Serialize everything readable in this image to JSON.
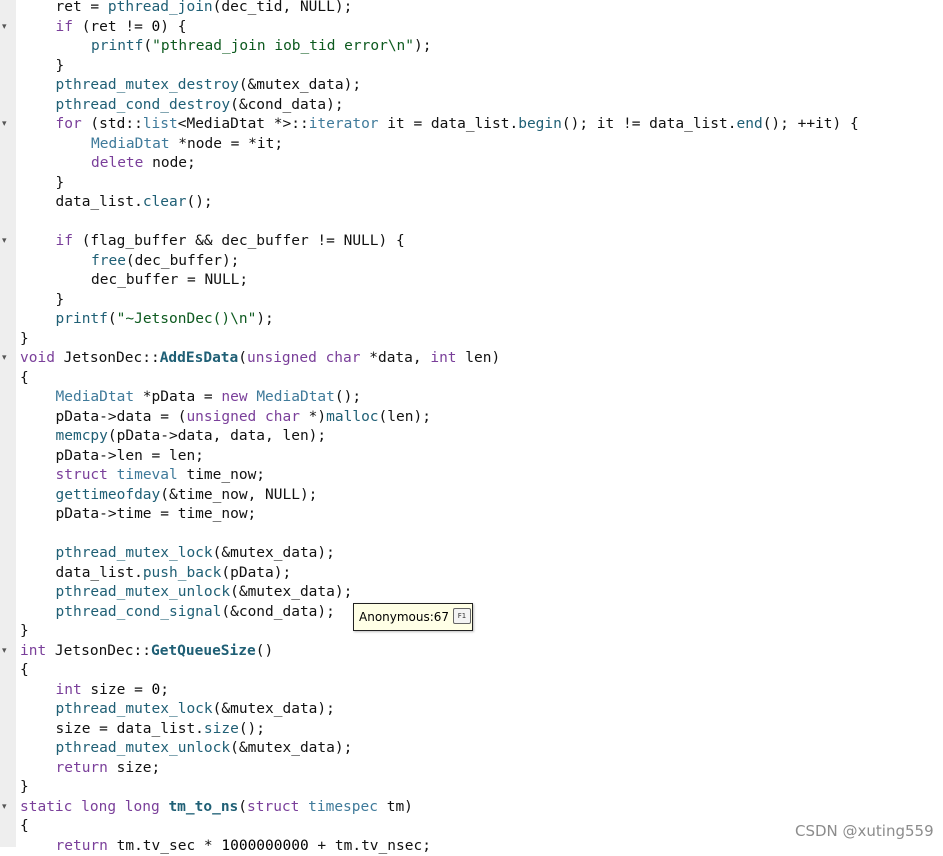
{
  "editor": {
    "lines": [
      {
        "fold": false,
        "indent": 1,
        "tokens": [
          [
            "pl",
            "ret = "
          ],
          [
            "fn",
            "pthread_join"
          ],
          [
            "pl",
            "(dec_tid, NULL);"
          ]
        ]
      },
      {
        "fold": true,
        "indent": 1,
        "tokens": [
          [
            "kw",
            "if"
          ],
          [
            "pl",
            " (ret != "
          ],
          [
            "nm",
            "0"
          ],
          [
            "pl",
            ") {"
          ]
        ]
      },
      {
        "fold": false,
        "indent": 2,
        "tokens": [
          [
            "fn",
            "printf"
          ],
          [
            "pl",
            "("
          ],
          [
            "st",
            "\"pthread_join iob_tid error\\n\""
          ],
          [
            "pl",
            ");"
          ]
        ]
      },
      {
        "fold": false,
        "indent": 1,
        "tokens": [
          [
            "pl",
            "}"
          ]
        ]
      },
      {
        "fold": false,
        "indent": 1,
        "tokens": [
          [
            "fn",
            "pthread_mutex_destroy"
          ],
          [
            "pl",
            "(&mutex_data);"
          ]
        ]
      },
      {
        "fold": false,
        "indent": 1,
        "tokens": [
          [
            "fn",
            "pthread_cond_destroy"
          ],
          [
            "pl",
            "(&cond_data);"
          ]
        ]
      },
      {
        "fold": true,
        "indent": 1,
        "tokens": [
          [
            "kw",
            "for"
          ],
          [
            "pl",
            " (std::"
          ],
          [
            "ty",
            "list"
          ],
          [
            "pl",
            "<MediaDtat *>::"
          ],
          [
            "ty",
            "iterator"
          ],
          [
            "pl",
            " it = data_list."
          ],
          [
            "fn",
            "begin"
          ],
          [
            "pl",
            "(); it != data_list."
          ],
          [
            "fn",
            "end"
          ],
          [
            "pl",
            "(); ++it) {"
          ]
        ]
      },
      {
        "fold": false,
        "indent": 2,
        "tokens": [
          [
            "ty",
            "MediaDtat"
          ],
          [
            "pl",
            " *node = *it;"
          ]
        ]
      },
      {
        "fold": false,
        "indent": 2,
        "tokens": [
          [
            "kw",
            "delete"
          ],
          [
            "pl",
            " node;"
          ]
        ]
      },
      {
        "fold": false,
        "indent": 1,
        "tokens": [
          [
            "pl",
            "}"
          ]
        ]
      },
      {
        "fold": false,
        "indent": 1,
        "tokens": [
          [
            "pl",
            "data_list."
          ],
          [
            "fn",
            "clear"
          ],
          [
            "pl",
            "();"
          ]
        ]
      },
      {
        "fold": false,
        "indent": 0,
        "tokens": []
      },
      {
        "fold": true,
        "indent": 1,
        "tokens": [
          [
            "kw",
            "if"
          ],
          [
            "pl",
            " (flag_buffer && dec_buffer != NULL) {"
          ]
        ]
      },
      {
        "fold": false,
        "indent": 2,
        "tokens": [
          [
            "fn",
            "free"
          ],
          [
            "pl",
            "(dec_buffer);"
          ]
        ]
      },
      {
        "fold": false,
        "indent": 2,
        "tokens": [
          [
            "pl",
            "dec_buffer = NULL;"
          ]
        ]
      },
      {
        "fold": false,
        "indent": 1,
        "tokens": [
          [
            "pl",
            "}"
          ]
        ]
      },
      {
        "fold": false,
        "indent": 1,
        "tokens": [
          [
            "fn",
            "printf"
          ],
          [
            "pl",
            "("
          ],
          [
            "st",
            "\"~JetsonDec()\\n\""
          ],
          [
            "pl",
            ");"
          ]
        ]
      },
      {
        "fold": false,
        "indent": 0,
        "tokens": [
          [
            "pl",
            "}"
          ]
        ]
      },
      {
        "fold": true,
        "indent": 0,
        "tokens": [
          [
            "kw",
            "void"
          ],
          [
            "pl",
            " JetsonDec::"
          ],
          [
            "fd",
            "AddEsData"
          ],
          [
            "pl",
            "("
          ],
          [
            "kw",
            "unsigned"
          ],
          [
            "pl",
            " "
          ],
          [
            "kw",
            "char"
          ],
          [
            "pl",
            " *data, "
          ],
          [
            "kw",
            "int"
          ],
          [
            "pl",
            " len)"
          ]
        ]
      },
      {
        "fold": false,
        "indent": 0,
        "tokens": [
          [
            "pl",
            "{"
          ]
        ]
      },
      {
        "fold": false,
        "indent": 1,
        "tokens": [
          [
            "ty",
            "MediaDtat"
          ],
          [
            "pl",
            " *pData = "
          ],
          [
            "kw",
            "new"
          ],
          [
            "pl",
            " "
          ],
          [
            "ty",
            "MediaDtat"
          ],
          [
            "pl",
            "();"
          ]
        ]
      },
      {
        "fold": false,
        "indent": 1,
        "tokens": [
          [
            "pl",
            "pData->data = ("
          ],
          [
            "kw",
            "unsigned"
          ],
          [
            "pl",
            " "
          ],
          [
            "kw",
            "char"
          ],
          [
            "pl",
            " *)"
          ],
          [
            "fn",
            "malloc"
          ],
          [
            "pl",
            "(len);"
          ]
        ]
      },
      {
        "fold": false,
        "indent": 1,
        "tokens": [
          [
            "fn",
            "memcpy"
          ],
          [
            "pl",
            "(pData->data, data, len);"
          ]
        ]
      },
      {
        "fold": false,
        "indent": 1,
        "tokens": [
          [
            "pl",
            "pData->len = len;"
          ]
        ]
      },
      {
        "fold": false,
        "indent": 1,
        "tokens": [
          [
            "kw",
            "struct"
          ],
          [
            "pl",
            " "
          ],
          [
            "ty",
            "timeval"
          ],
          [
            "pl",
            " time_now;"
          ]
        ]
      },
      {
        "fold": false,
        "indent": 1,
        "tokens": [
          [
            "fn",
            "gettimeofday"
          ],
          [
            "pl",
            "(&time_now, NULL);"
          ]
        ]
      },
      {
        "fold": false,
        "indent": 1,
        "tokens": [
          [
            "pl",
            "pData->time = time_now;"
          ]
        ]
      },
      {
        "fold": false,
        "indent": 0,
        "tokens": []
      },
      {
        "fold": false,
        "indent": 1,
        "tokens": [
          [
            "fn",
            "pthread_mutex_lock"
          ],
          [
            "pl",
            "(&mutex_data);"
          ]
        ]
      },
      {
        "fold": false,
        "indent": 1,
        "tokens": [
          [
            "pl",
            "data_list."
          ],
          [
            "fn",
            "push_back"
          ],
          [
            "pl",
            "(pData);"
          ]
        ]
      },
      {
        "fold": false,
        "indent": 1,
        "tokens": [
          [
            "fn",
            "pthread_mutex_unlock"
          ],
          [
            "pl",
            "(&mutex_data);"
          ]
        ]
      },
      {
        "fold": false,
        "indent": 1,
        "tokens": [
          [
            "fn",
            "pthread_cond_signal"
          ],
          [
            "pl",
            "(&cond_data);"
          ]
        ]
      },
      {
        "fold": false,
        "indent": 0,
        "tokens": [
          [
            "pl",
            "}"
          ]
        ]
      },
      {
        "fold": true,
        "indent": 0,
        "tokens": [
          [
            "kw",
            "int"
          ],
          [
            "pl",
            " JetsonDec::"
          ],
          [
            "fd",
            "GetQueueSize"
          ],
          [
            "pl",
            "()"
          ]
        ]
      },
      {
        "fold": false,
        "indent": 0,
        "tokens": [
          [
            "pl",
            "{"
          ]
        ]
      },
      {
        "fold": false,
        "indent": 1,
        "tokens": [
          [
            "kw",
            "int"
          ],
          [
            "pl",
            " size = "
          ],
          [
            "nm",
            "0"
          ],
          [
            "pl",
            ";"
          ]
        ]
      },
      {
        "fold": false,
        "indent": 1,
        "tokens": [
          [
            "fn",
            "pthread_mutex_lock"
          ],
          [
            "pl",
            "(&mutex_data);"
          ]
        ]
      },
      {
        "fold": false,
        "indent": 1,
        "tokens": [
          [
            "pl",
            "size = data_list."
          ],
          [
            "fn",
            "size"
          ],
          [
            "pl",
            "();"
          ]
        ]
      },
      {
        "fold": false,
        "indent": 1,
        "tokens": [
          [
            "fn",
            "pthread_mutex_unlock"
          ],
          [
            "pl",
            "(&mutex_data);"
          ]
        ]
      },
      {
        "fold": false,
        "indent": 1,
        "tokens": [
          [
            "kw",
            "return"
          ],
          [
            "pl",
            " size;"
          ]
        ]
      },
      {
        "fold": false,
        "indent": 0,
        "tokens": [
          [
            "pl",
            "}"
          ]
        ]
      },
      {
        "fold": true,
        "indent": 0,
        "tokens": [
          [
            "kw",
            "static"
          ],
          [
            "pl",
            " "
          ],
          [
            "kw",
            "long"
          ],
          [
            "pl",
            " "
          ],
          [
            "kw",
            "long"
          ],
          [
            "pl",
            " "
          ],
          [
            "fd",
            "tm_to_ns"
          ],
          [
            "pl",
            "("
          ],
          [
            "kw",
            "struct"
          ],
          [
            "pl",
            " "
          ],
          [
            "ty",
            "timespec"
          ],
          [
            "pl",
            " tm)"
          ]
        ]
      },
      {
        "fold": false,
        "indent": 0,
        "tokens": [
          [
            "pl",
            "{"
          ]
        ]
      },
      {
        "fold": false,
        "indent": 1,
        "tokens": [
          [
            "kw",
            "return"
          ],
          [
            "pl",
            " tm.tv_sec * "
          ],
          [
            "nm",
            "1000000000"
          ],
          [
            "pl",
            " + tm.tv_nsec;"
          ]
        ]
      }
    ],
    "fold_icon": "fold-arrow-icon"
  },
  "tooltip": {
    "text": "Anonymous:67",
    "key_label": "F1"
  },
  "watermark": {
    "text": "CSDN @xuting559"
  },
  "colors": {
    "keyword": "#7a3f9a",
    "type": "#3f7a9a",
    "function": "#1f5f75",
    "string": "#0d5a1f",
    "gutter": "#eeeeee",
    "tooltip_bg": "#ffffe6"
  }
}
